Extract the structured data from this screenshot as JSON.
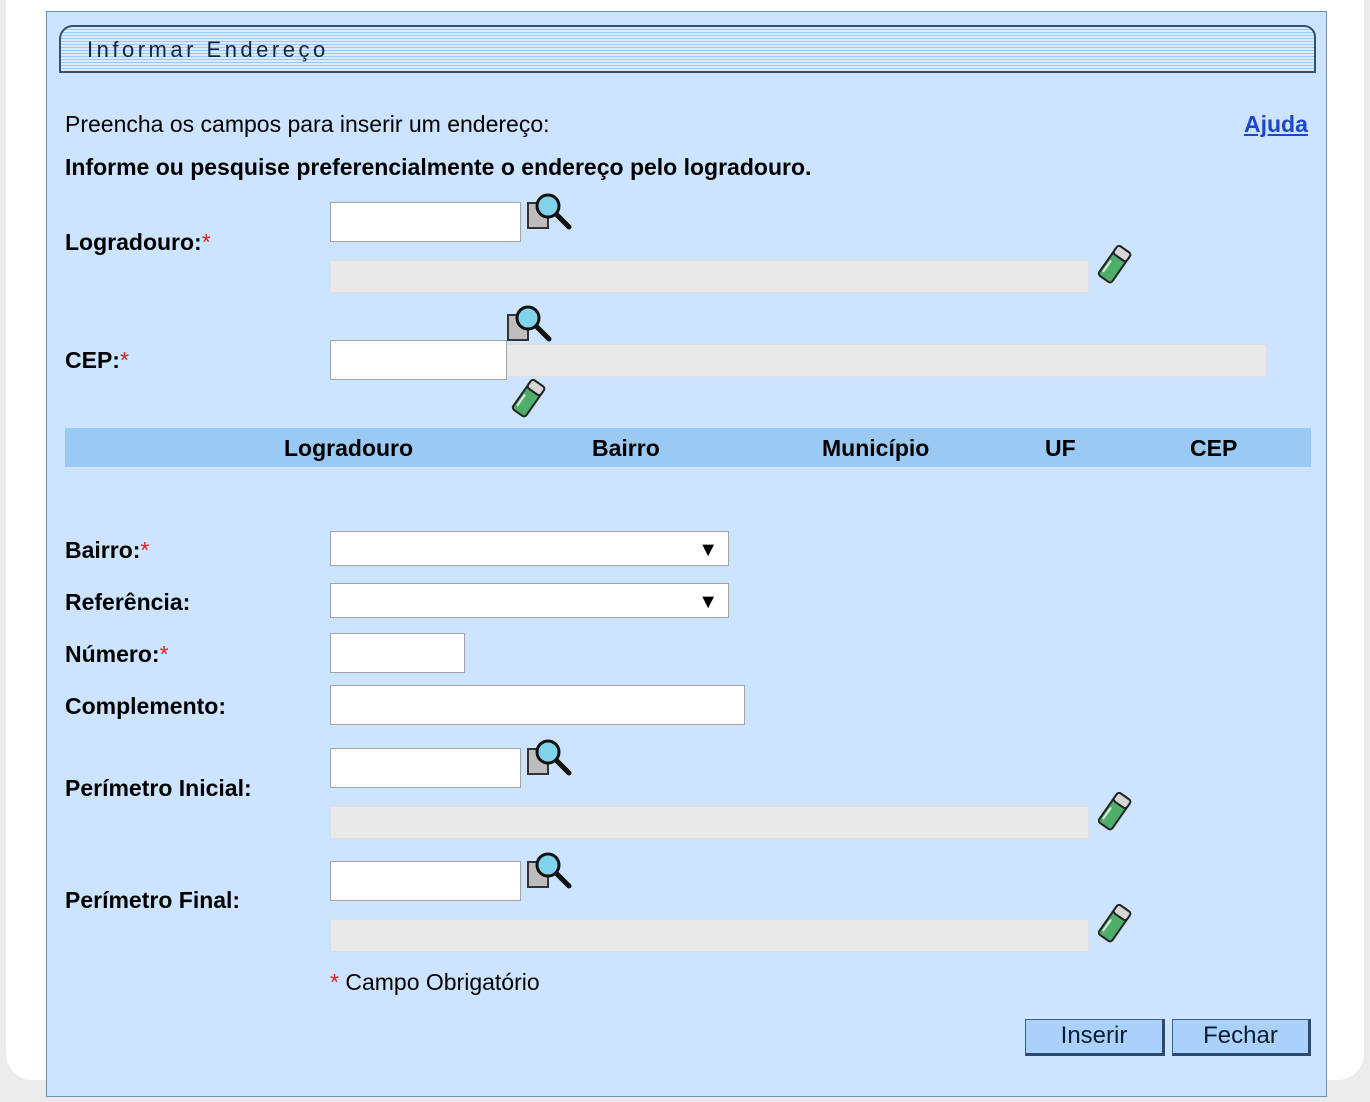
{
  "header": {
    "title": "Informar Endereço"
  },
  "intro": {
    "instruction": "Preencha os campos para inserir um endereço:",
    "help_link": "Ajuda",
    "hint": "Informe ou pesquise preferencialmente o endereço pelo logradouro."
  },
  "form": {
    "logradouro": {
      "label": "Logradouro:",
      "required": "*",
      "code_value": "",
      "description": ""
    },
    "cep": {
      "label": "CEP:",
      "required": "*",
      "code_value": "",
      "description": ""
    },
    "bairro": {
      "label": "Bairro:",
      "required": "*",
      "selected": ""
    },
    "referencia": {
      "label": "Referência:",
      "selected": ""
    },
    "numero": {
      "label": "Número:",
      "required": "*",
      "value": ""
    },
    "complemento": {
      "label": "Complemento:",
      "value": ""
    },
    "perimetro_inicial": {
      "label": "Perímetro Inicial:",
      "code_value": "",
      "description": ""
    },
    "perimetro_final": {
      "label": "Perímetro Final:",
      "code_value": "",
      "description": ""
    }
  },
  "results_table": {
    "columns": [
      "Logradouro",
      "Bairro",
      "Município",
      "UF",
      "CEP"
    ],
    "rows": []
  },
  "footer": {
    "required_mark": "*",
    "required_note": "Campo Obrigatório",
    "insert_button": "Inserir",
    "close_button": "Fechar"
  },
  "icons": {
    "search": "magnifier-search-icon",
    "clear": "eraser-clear-icon"
  },
  "colors": {
    "panel_background": "#cce4ff",
    "table_header": "#9ac9f3",
    "required": "#e02020",
    "link": "#1e46c8"
  }
}
